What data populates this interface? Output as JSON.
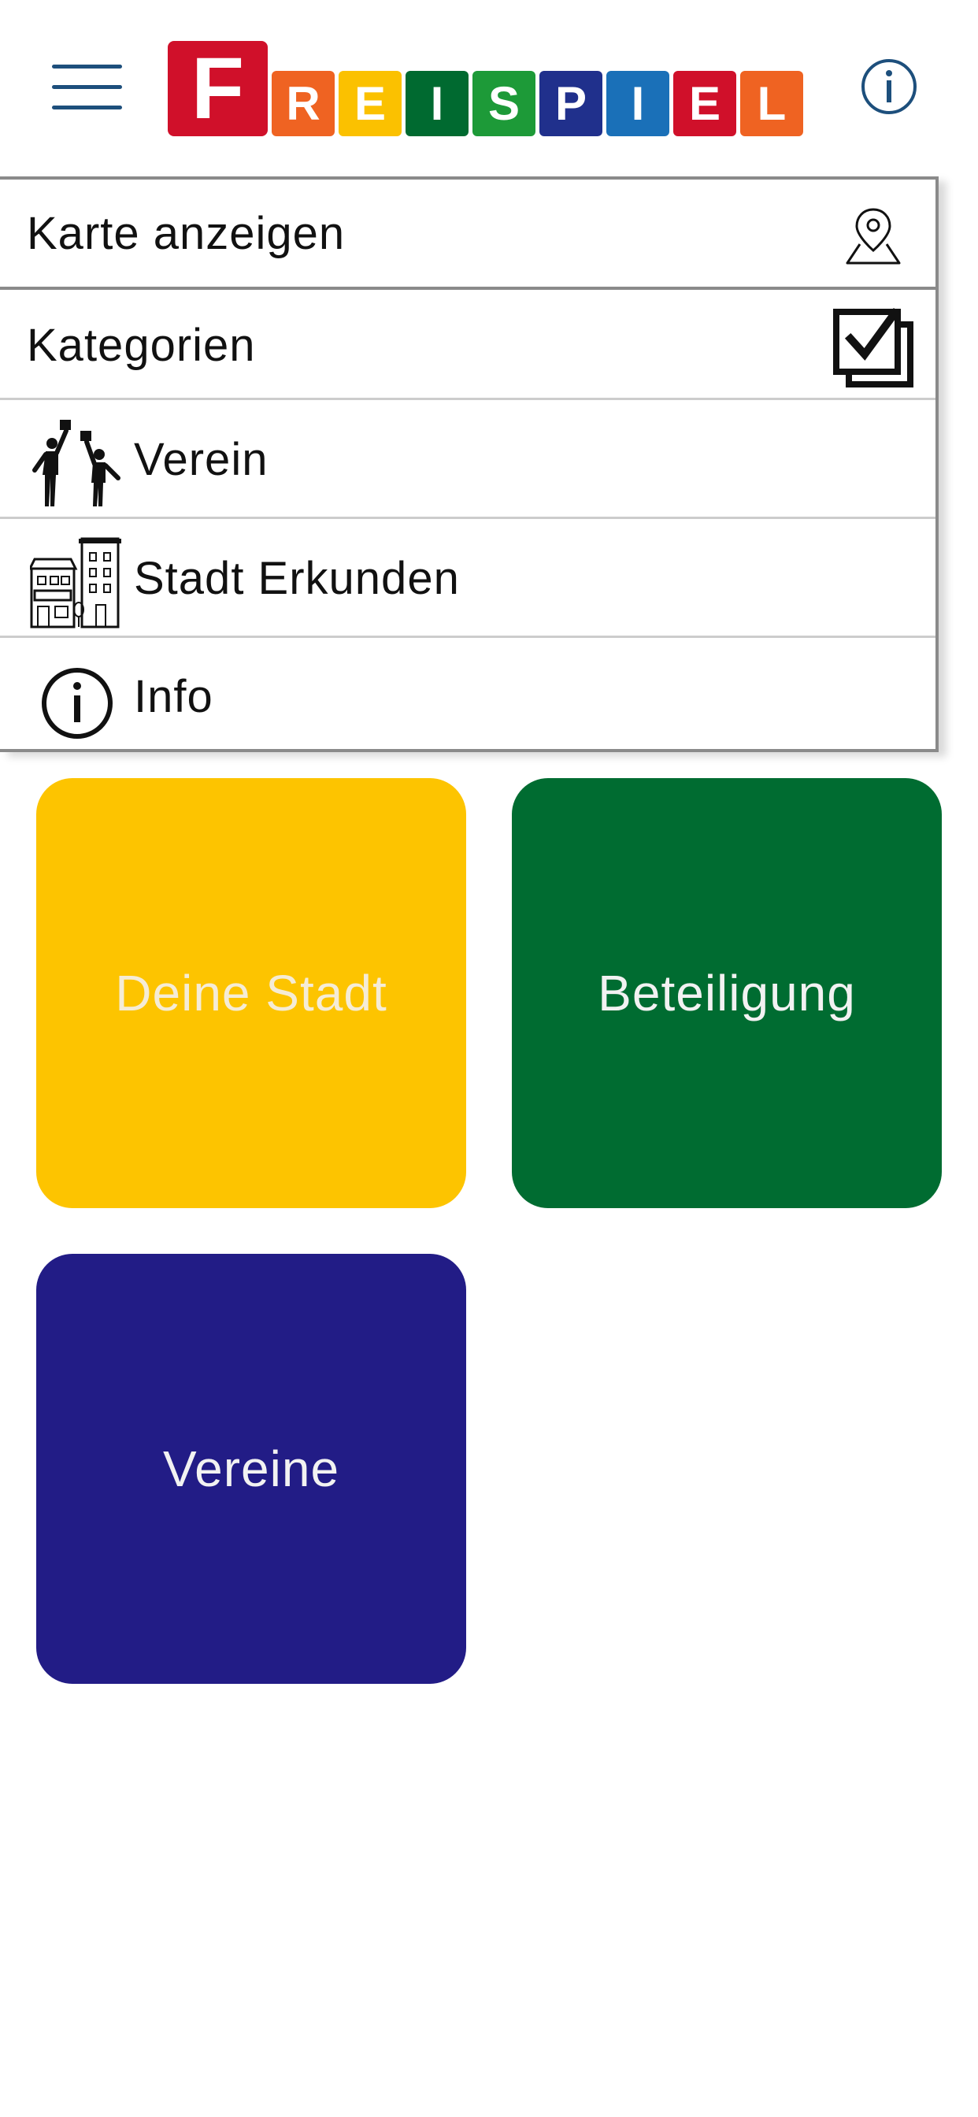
{
  "header": {
    "menu_icon": "hamburger-icon",
    "info_icon": "info-circle-icon",
    "logo": {
      "letters": [
        {
          "char": "F",
          "color": "#d0102a"
        },
        {
          "char": "R",
          "color": "#ef6322"
        },
        {
          "char": "E",
          "color": "#fbc100"
        },
        {
          "char": "I",
          "color": "#006a30"
        },
        {
          "char": "S",
          "color": "#1d9a38"
        },
        {
          "char": "P",
          "color": "#20308c"
        },
        {
          "char": "I",
          "color": "#1a70b8"
        },
        {
          "char": "E",
          "color": "#d0102a"
        },
        {
          "char": "L",
          "color": "#ef6322"
        }
      ]
    }
  },
  "menu": {
    "show_map": {
      "label": "Karte anzeigen",
      "icon": "map-pin-icon"
    },
    "categories": {
      "label": "Kategorien",
      "icon": "multi-checkbox-icon"
    },
    "items": [
      {
        "label": "Verein",
        "icon": "club-people-icon"
      },
      {
        "label": "Stadt Erkunden",
        "icon": "city-buildings-icon"
      },
      {
        "label": "Info",
        "icon": "info-circle-icon"
      }
    ]
  },
  "tiles": [
    {
      "label": "Deine Stadt",
      "bg": "#fdc400",
      "fg": "#f5ecd6"
    },
    {
      "label": "Beteiligung",
      "bg": "#006c31",
      "fg": "#f2f2f2"
    },
    {
      "label": "Vereine",
      "bg": "#221c86",
      "fg": "#f2f2f2"
    }
  ],
  "colors": {
    "menu_border": "#8a8a8a",
    "header_icon": "#1d4f7c"
  }
}
